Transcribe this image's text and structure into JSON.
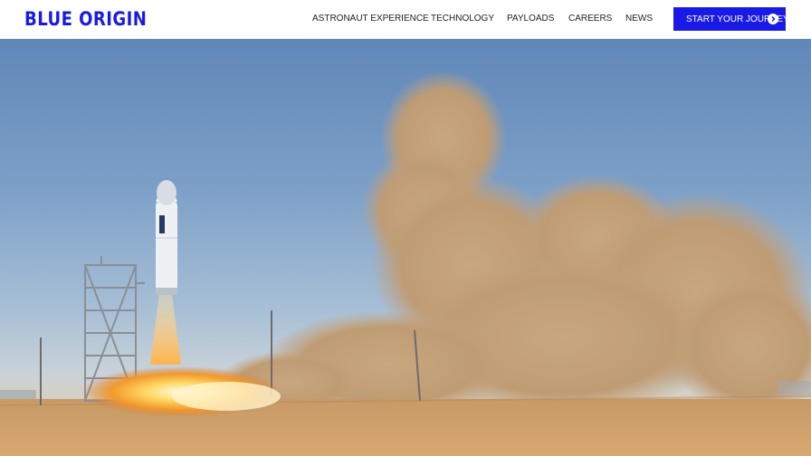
{
  "brand": {
    "logo_text": "BLUE ORIGIN",
    "accent_color": "#1a1ae6"
  },
  "nav": {
    "items": [
      {
        "label": "ASTRONAUT EXPERIENCE"
      },
      {
        "label": "TECHNOLOGY"
      },
      {
        "label": "PAYLOADS"
      },
      {
        "label": "CAREERS"
      },
      {
        "label": "NEWS"
      }
    ],
    "cta": {
      "label": "START YOUR JOURNEY",
      "icon": "chevron-right-circle-icon"
    }
  },
  "hero": {
    "image": "rocket-launch-photo"
  }
}
